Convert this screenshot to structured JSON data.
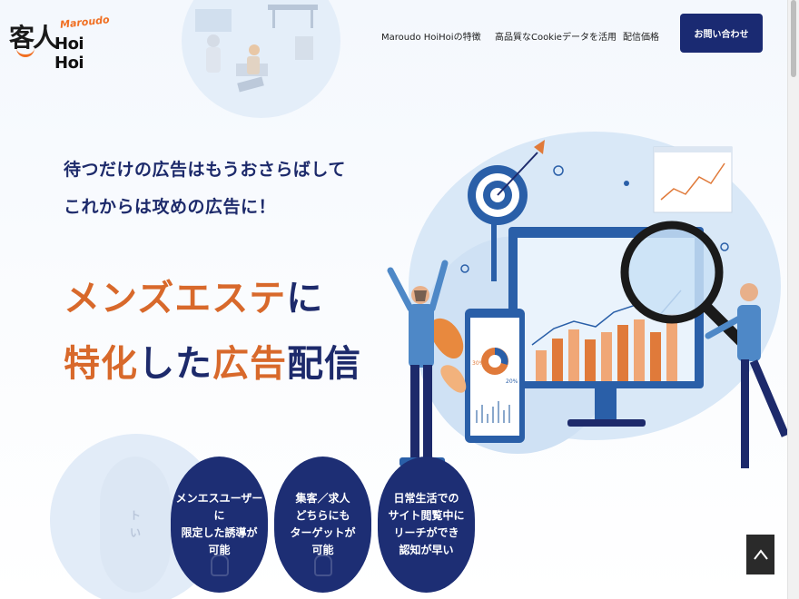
{
  "header": {
    "logo_kanji": "客人",
    "logo_roman": "Maroudo",
    "logo_hoi": "Hoi Hoi",
    "nav": [
      "Maroudo HoiHoiの特徴",
      "高品質なCookieデータを活用",
      "配信価格"
    ],
    "contact_label": "お問い合わせ"
  },
  "hero": {
    "tagline_line1": "待つだけの広告はもうおさらばして",
    "tagline_line2": "これからは攻めの広告に！",
    "headline_line1_orange": "メンズエステ",
    "headline_line1_navy": "に",
    "headline_line2_orange1": "特化",
    "headline_line2_navy1": "した",
    "headline_line2_orange2": "広告",
    "headline_line2_navy2": "配信"
  },
  "features": [
    {
      "lines": [
        "ト",
        "",
        "い"
      ]
    },
    {
      "lines": [
        "メンエスユーザーに",
        "限定した誘導が",
        "可能"
      ]
    },
    {
      "lines": [
        "集客／求人",
        "どちらにも",
        "ターゲットが",
        "可能"
      ]
    },
    {
      "lines": [
        "日常生活での",
        "サイト閲覧中に",
        "リーチができ",
        "認知が早い"
      ]
    }
  ],
  "illustration": {
    "pie_labels": [
      "30%",
      "20%"
    ]
  },
  "colors": {
    "navy": "#1d2a6b",
    "orange": "#d8692b",
    "button": "#1a2a72"
  },
  "icons": {
    "back_to_top": "chevron-up-icon"
  }
}
